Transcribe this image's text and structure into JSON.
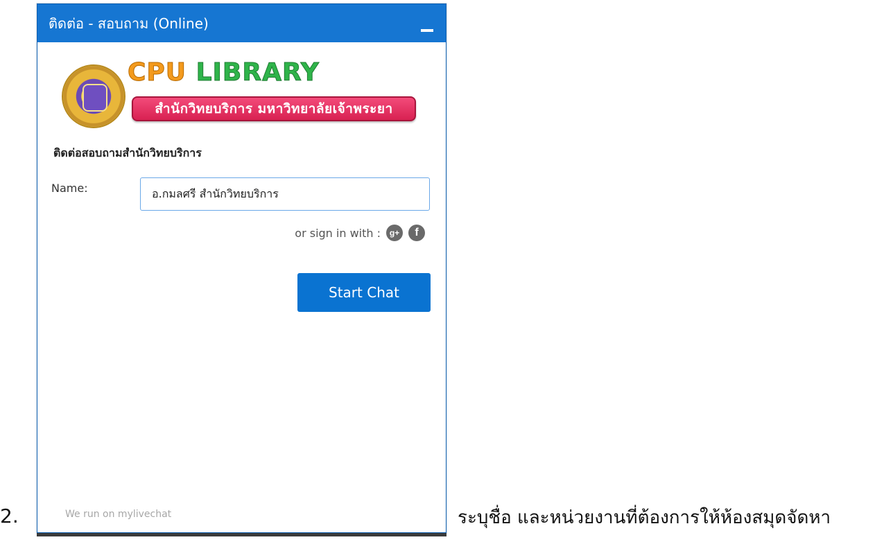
{
  "doc": {
    "step_number": "2.",
    "caption": "ระบุชื่อ และหน่วยงานที่ต้องการให้ห้องสมุดจัดหา"
  },
  "window": {
    "title": "ติดต่อ - สอบถาม (Online)"
  },
  "logo": {
    "word1": "CPU",
    "word2": "LIBRARY",
    "banner": "สำนักวิทยบริการ มหาวิทยาลัยเจ้าพระยา"
  },
  "form": {
    "heading": "ติดต่อสอบถามสำนักวิทยบริการ",
    "name_label": "Name:",
    "name_value": "อ.กมลศรี สำนักวิทยบริการ",
    "signin_text": "or sign in with :",
    "start_button": "Start Chat"
  },
  "icons": {
    "google_plus": "google-plus-icon",
    "facebook": "facebook-icon"
  },
  "footer": {
    "powered_by": "We run on mylivechat"
  },
  "colors": {
    "titlebar": "#1676d2",
    "button": "#0a73d1",
    "banner": "#e5356a"
  }
}
